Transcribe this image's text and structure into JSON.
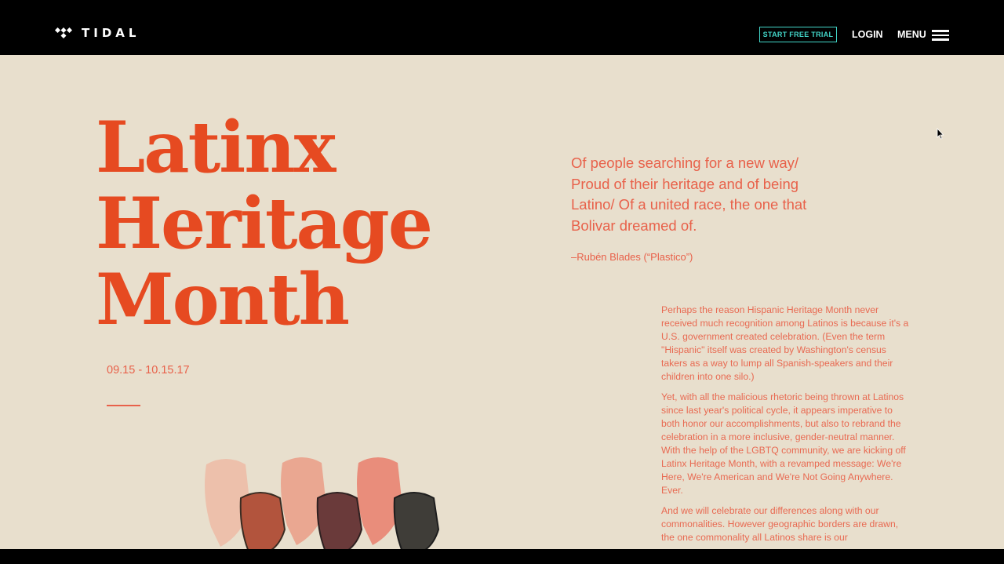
{
  "header": {
    "logo_text": "TIDAL",
    "trial_button": "START FREE TRIAL",
    "login": "LOGIN",
    "menu": "MENU"
  },
  "hero": {
    "title_lines": [
      "Latinx",
      "Heritage",
      "Month"
    ],
    "dates": "09.15 - 10.15.17"
  },
  "quote": {
    "text": "Of people searching for a new way/ Proud of their heritage and of being Latino/ Of a united race, the one that Bolivar dreamed of.",
    "attribution": "–Rubén Blades (“Plastico”)"
  },
  "body": {
    "paragraphs": [
      "Perhaps the reason Hispanic Heritage Month never received much recognition among Latinos is because it's a U.S. government created celebration. (Even the term \"Hispanic\" itself was created by Washington's census takers as a way to lump all Spanish-speakers and their children into one silo.)",
      "Yet, with all the malicious rhetoric being thrown at Latinos since last year's political cycle, it appears imperative to both honor our accomplishments, but also to rebrand the celebration in a more inclusive, gender-neutral manner. With the help of the LGBTQ community, we are kicking off Latinx Heritage Month, with a revamped message: We're Here, We're American and We're Not Going Anywhere. Ever.",
      "And we will celebrate our differences along with our commonalities. However geographic borders are drawn, the one commonality all Latinos share is our"
    ]
  },
  "colors": {
    "accent": "#e64a21",
    "text_coral": "#e8614a",
    "teal": "#43d6c9",
    "background": "#e8dfcd"
  },
  "icons": [
    "tidal-logo-icon",
    "hamburger-icon",
    "cursor-icon",
    "raised-fist-icon"
  ]
}
